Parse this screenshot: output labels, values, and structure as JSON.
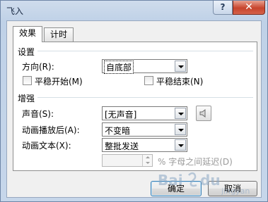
{
  "window": {
    "title": "飞入",
    "help_label": "?",
    "close_label": "✕"
  },
  "tabs": [
    {
      "label": "效果",
      "active": true
    },
    {
      "label": "计时",
      "active": false
    }
  ],
  "settings": {
    "group_title": "设置",
    "direction_label": "方向(R):",
    "direction_value": "自底部",
    "smooth_start_label": "平稳开始(M)",
    "smooth_start_checked": false,
    "smooth_end_label": "平稳结束(N)",
    "smooth_end_checked": false
  },
  "enhancements": {
    "group_title": "增强",
    "sound_label": "声音(S):",
    "sound_value": "[无声音]",
    "after_animation_label": "动画播放后(A):",
    "after_animation_value": "不变暗",
    "animate_text_label": "动画文本(X):",
    "animate_text_value": "整批发送",
    "delay_value": "",
    "delay_suffix": "% 字母之间延迟(D)"
  },
  "buttons": {
    "ok_label": "确定",
    "cancel_label": "取消"
  },
  "watermark_text": "Baidu 经验",
  "icons": {
    "sound": "speaker-icon",
    "dropdown": "chevron-down-icon",
    "close": "close-icon",
    "help": "help-icon"
  }
}
